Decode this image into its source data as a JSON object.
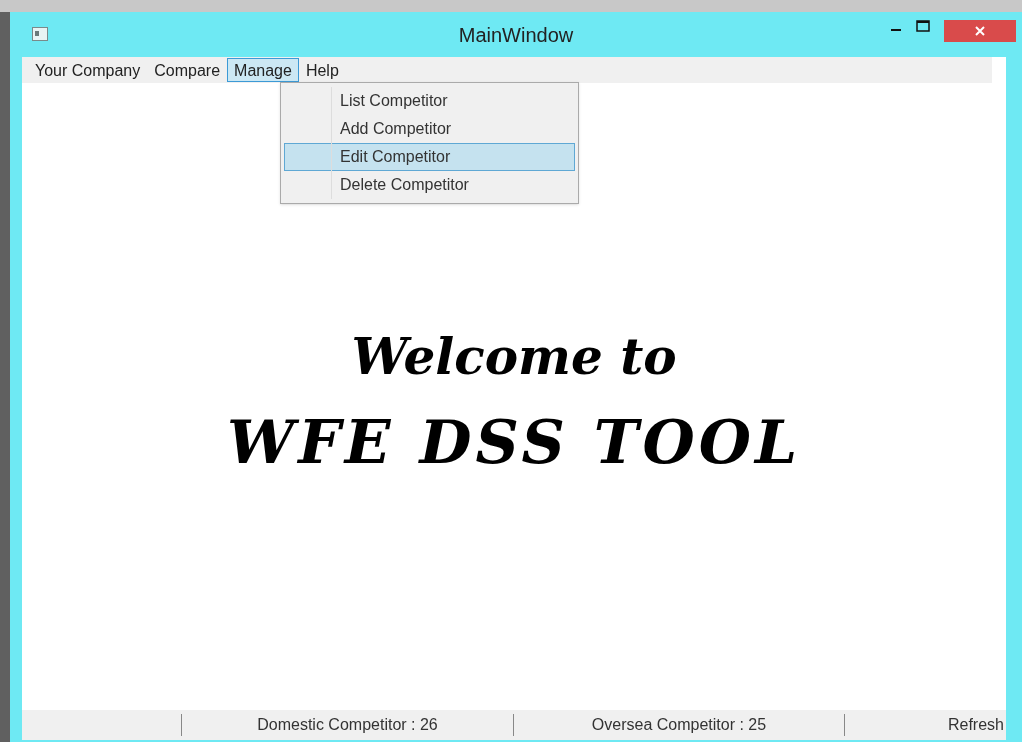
{
  "window": {
    "title": "MainWindow"
  },
  "menu": [
    {
      "label": "Your Company",
      "selected": false
    },
    {
      "label": "Compare",
      "selected": false
    },
    {
      "label": "Manage",
      "selected": true
    },
    {
      "label": "Help",
      "selected": false
    }
  ],
  "dropdown": [
    {
      "label": "List Competitor",
      "selected": false
    },
    {
      "label": "Add Competitor",
      "selected": false
    },
    {
      "label": "Edit Competitor",
      "selected": true
    },
    {
      "label": "Delete Competitor",
      "selected": false
    }
  ],
  "welcome": {
    "line_1": "Welcome to",
    "line_2": "WFE DSS TOOL"
  },
  "status_bar": {
    "domestic": "Domestic Competitor : 26",
    "oversea": "Oversea Competitor : 25",
    "refresh": "Refresh"
  }
}
